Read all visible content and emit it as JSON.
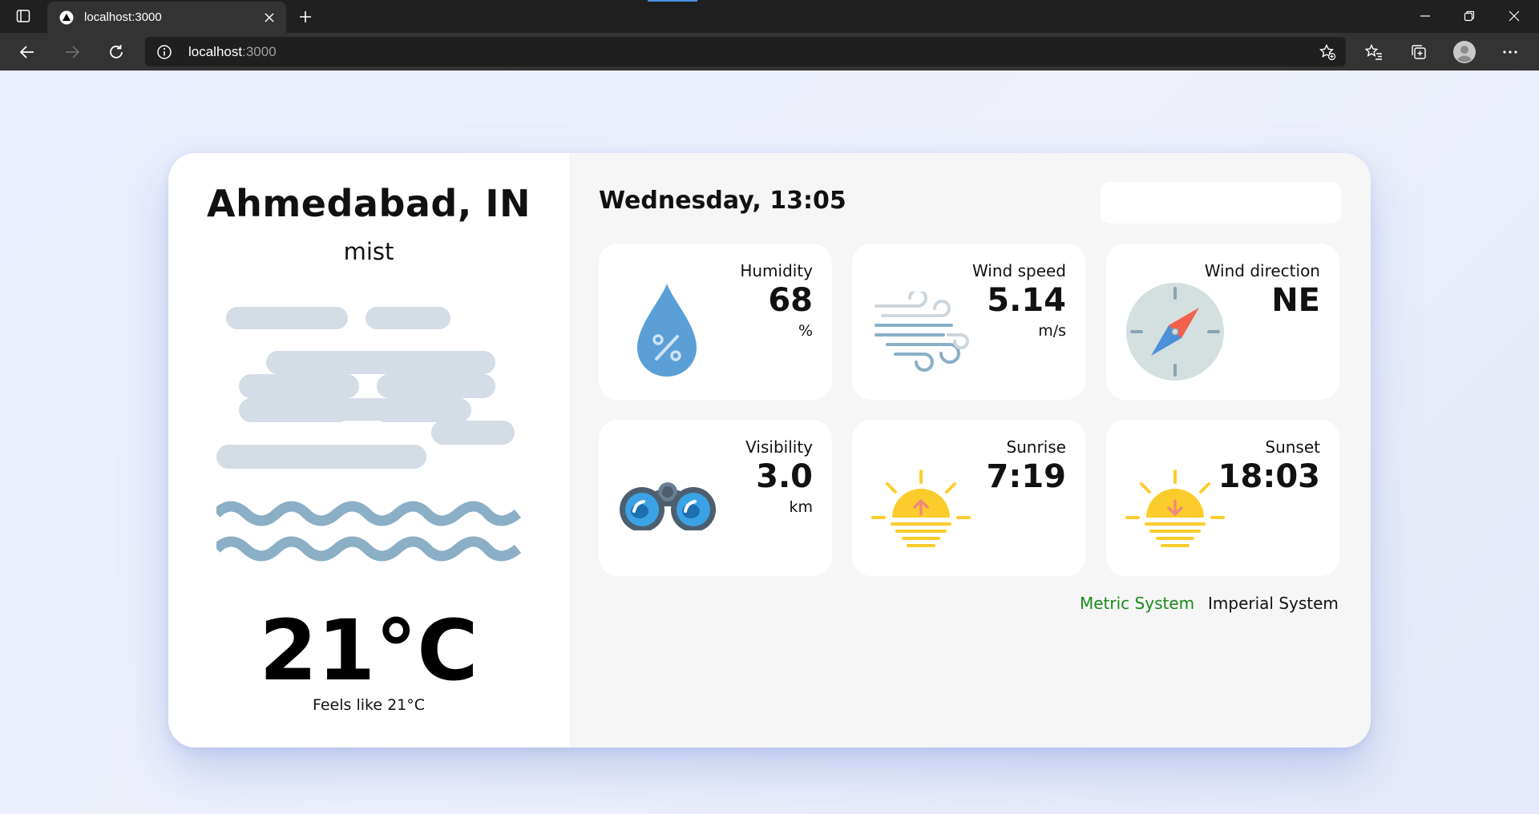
{
  "browser": {
    "tab_title": "localhost:3000",
    "address_host": "localhost",
    "address_port": ":3000"
  },
  "weather": {
    "city": "Ahmedabad, IN",
    "description": "mist",
    "temperature": "21",
    "temperature_unit": "°C",
    "feels_like": "Feels like 21°C"
  },
  "main": {
    "datetime": "Wednesday, 13:05",
    "search_value": "",
    "tiles": [
      {
        "label": "Humidity",
        "value": "68",
        "unit": "%"
      },
      {
        "label": "Wind speed",
        "value": "5.14",
        "unit": "m/s"
      },
      {
        "label": "Wind direction",
        "value": "NE",
        "unit": ""
      },
      {
        "label": "Visibility",
        "value": "3.0",
        "unit": "km"
      },
      {
        "label": "Sunrise",
        "value": "7:19",
        "unit": ""
      },
      {
        "label": "Sunset",
        "value": "18:03",
        "unit": ""
      }
    ],
    "unit_options": {
      "metric": "Metric System",
      "imperial": "Imperial System",
      "active": "metric"
    }
  },
  "colors": {
    "metric_active": "#1a8a1a",
    "page_background": "#e9eefc",
    "water_drop": "#5a9fd6",
    "sun": "#fbcd2c",
    "waves": "#8aafc6",
    "clouds": "#d4dce6"
  },
  "icons": {
    "humidity": "water-drop-percent-icon",
    "wind_speed": "wind-icon",
    "wind_direction": "compass-icon",
    "visibility": "binoculars-icon",
    "sunrise": "sunrise-icon",
    "sunset": "sunset-icon",
    "condition": "mist-icon"
  }
}
